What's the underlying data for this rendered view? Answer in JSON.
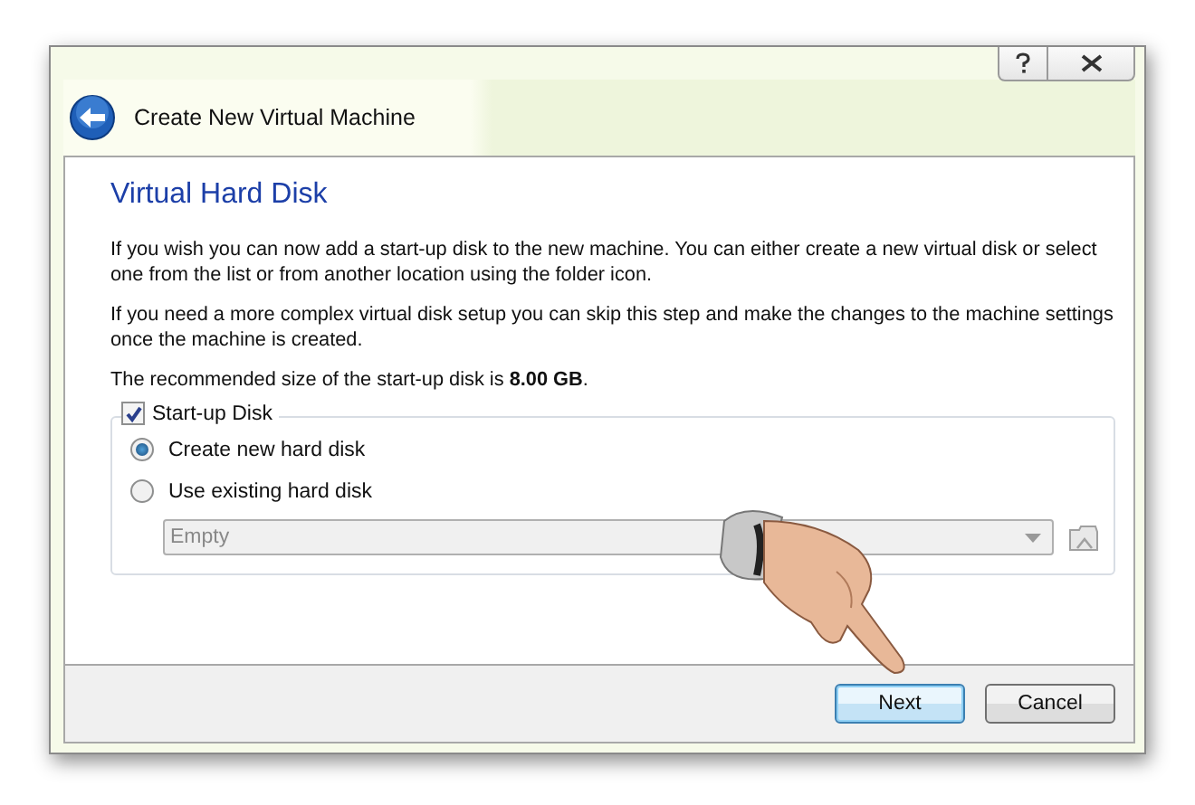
{
  "window": {
    "title": "Create New Virtual Machine"
  },
  "page": {
    "heading": "Virtual Hard Disk",
    "paragraphs": [
      "If you wish you can now add a start-up disk to the new machine. You can either create a new virtual disk or select one from the list or from another location using the folder icon.",
      "If you need a more complex virtual disk setup you can skip this step and make the changes to the machine settings once the machine is created.",
      "The recommended size of the start-up disk is **8.00 GB**."
    ]
  },
  "startup_disk": {
    "label": "Start-up Disk",
    "checked": true,
    "options": [
      {
        "label": "Create new hard disk",
        "selected": true
      },
      {
        "label": "Use existing hard disk",
        "selected": false
      }
    ],
    "disk_select": {
      "value": "Empty",
      "disabled": true
    }
  },
  "buttons": [
    {
      "label": "Next",
      "default": true
    },
    {
      "label": "Cancel",
      "default": false
    }
  ]
}
